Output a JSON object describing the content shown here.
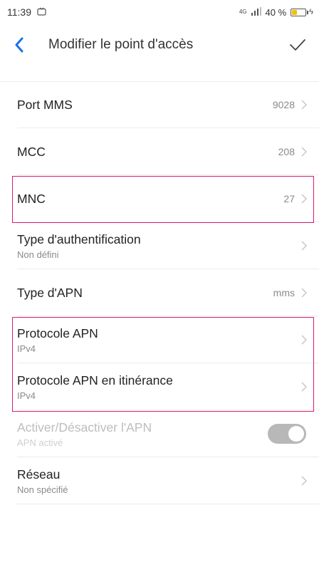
{
  "status_bar": {
    "time": "11:39",
    "network": "4G",
    "battery_percent": "40 %",
    "battery_level": 0.4
  },
  "header": {
    "title": "Modifier le point d'accès"
  },
  "rows": [
    {
      "label": "Port MMS",
      "value": "9028"
    },
    {
      "label": "MCC",
      "value": "208"
    },
    {
      "label": "MNC",
      "value": "27"
    },
    {
      "label": "Type d'authentification",
      "sub": "Non défini"
    },
    {
      "label": "Type d'APN",
      "value": "mms"
    },
    {
      "label": "Protocole APN",
      "sub": "IPv4"
    },
    {
      "label": "Protocole APN en itinérance",
      "sub": "IPv4"
    },
    {
      "label": "Activer/Désactiver l'APN",
      "sub": "APN activé",
      "toggle_on": true
    },
    {
      "label": "Réseau",
      "sub": "Non spécifié"
    }
  ],
  "colors": {
    "accent": "#1a73e8",
    "highlight": "#d81b7a"
  }
}
